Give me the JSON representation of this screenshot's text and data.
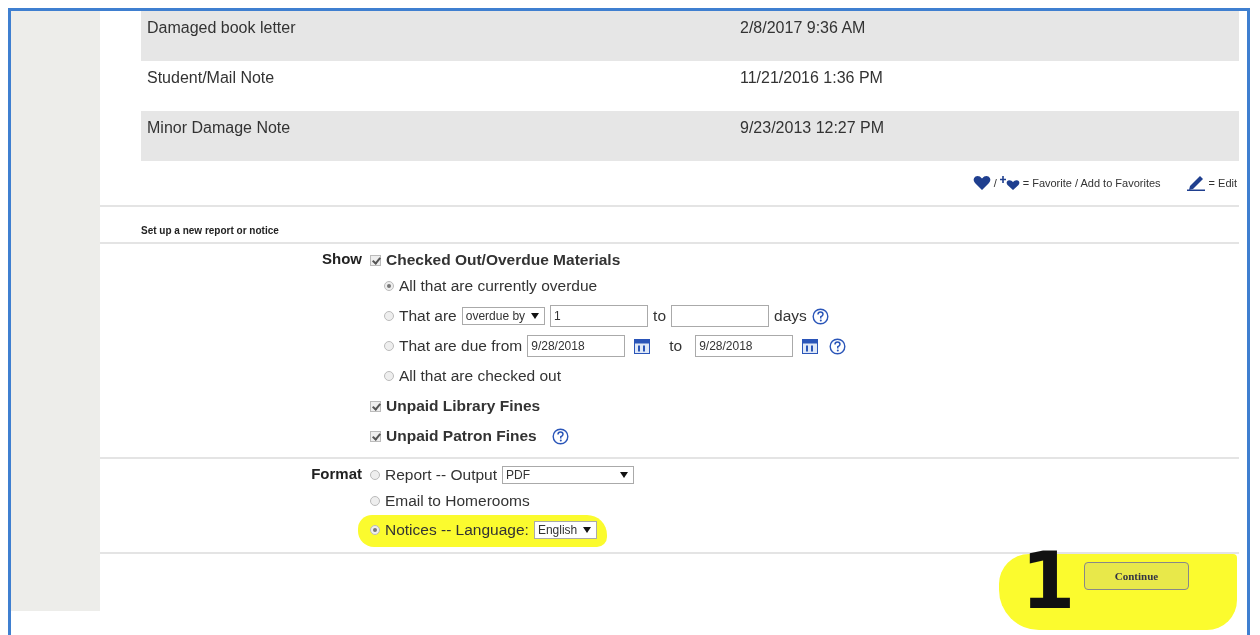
{
  "notes": [
    {
      "name": "Damaged book letter",
      "date": "2/8/2017 9:36 AM"
    },
    {
      "name": "Student/Mail Note",
      "date": "11/21/2016 1:36 PM"
    },
    {
      "name": "Minor Damage Note",
      "date": "9/23/2013 12:27 PM"
    }
  ],
  "legend": {
    "separator": "/",
    "favorite_label": "= Favorite / Add to Favorites",
    "edit_label": "= Edit"
  },
  "section_title": "Set up a new report or notice",
  "show": {
    "label": "Show",
    "materials": {
      "label": "Checked Out/Overdue Materials",
      "checked": true
    },
    "options": [
      {
        "kind": "plain",
        "label": "All that are currently overdue",
        "selected": true
      },
      {
        "kind": "range",
        "label": "That are",
        "select": "overdue by",
        "from": "1",
        "to_label": "to",
        "unit": "days",
        "selected": false
      },
      {
        "kind": "dates",
        "label": "That are due from",
        "from": "9/28/2018",
        "to_label": "to",
        "to": "9/28/2018",
        "selected": false
      },
      {
        "kind": "plain",
        "label": "All that are checked out",
        "selected": false
      }
    ],
    "fines": [
      {
        "label": "Unpaid Library Fines",
        "checked": true,
        "help": false
      },
      {
        "label": "Unpaid Patron Fines",
        "checked": true,
        "help": true
      }
    ]
  },
  "format": {
    "label": "Format",
    "options": [
      {
        "kind": "select",
        "label": "Report -- Output",
        "select": "PDF",
        "wide": true,
        "selected": false,
        "highlighted": false
      },
      {
        "kind": "plain",
        "label": "Email to Homerooms",
        "selected": false,
        "highlighted": false
      },
      {
        "kind": "select",
        "label": "Notices -- Language:",
        "select": "English",
        "wide": false,
        "selected": true,
        "highlighted": true
      }
    ]
  },
  "continue": {
    "label": "Continue",
    "highlighted": true
  },
  "annotation": "1"
}
